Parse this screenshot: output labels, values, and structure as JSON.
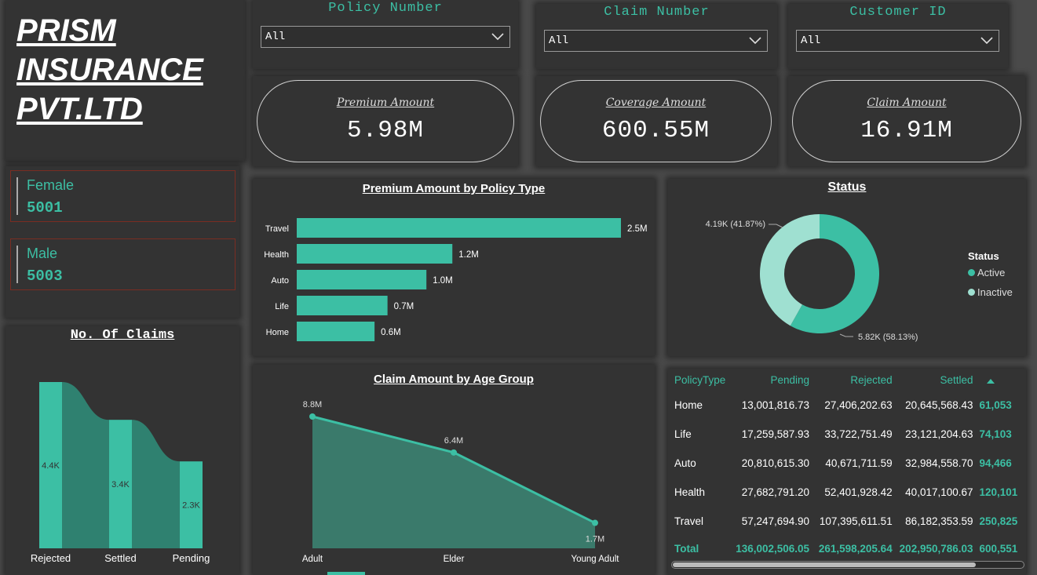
{
  "brand": {
    "line1": "PRISM ",
    "line2": "INSURANCE ",
    "line3": "PVT.LTD"
  },
  "filters": [
    {
      "label": "Policy Number",
      "value": "All"
    },
    {
      "label": "Claim Number",
      "value": "All"
    },
    {
      "label": "Customer ID",
      "value": "All"
    }
  ],
  "kpis": [
    {
      "label": "Premium Amount",
      "value": "5.98M"
    },
    {
      "label": "Coverage Amount",
      "value": "600.55M"
    },
    {
      "label": "Claim Amount",
      "value": "16.91M"
    }
  ],
  "gender": [
    {
      "label": "Female",
      "value": "5001"
    },
    {
      "label": "Male",
      "value": "5003"
    }
  ],
  "colors": {
    "accent": "#3cbfa4",
    "accent_light": "#9fe0d1",
    "panel": "#333333",
    "card_border": "#7a2d22"
  },
  "chart_data": [
    {
      "type": "bar",
      "title": "Premium Amount by Policy Type",
      "orientation": "horizontal",
      "categories": [
        "Travel",
        "Health",
        "Auto",
        "Life",
        "Home"
      ],
      "values": [
        2.5,
        1.2,
        1.0,
        0.7,
        0.6
      ],
      "labels": [
        "2.5M",
        "1.2M",
        "1.0M",
        "0.7M",
        "0.6M"
      ],
      "unit": "M"
    },
    {
      "type": "pie",
      "title": "Status",
      "legend_title": "Status",
      "legend_position": "right",
      "categories": [
        "Active",
        "Inactive"
      ],
      "values": [
        5.82,
        4.19
      ],
      "percents": [
        58.13,
        41.87
      ],
      "labels": [
        "5.82K (58.13%)",
        "4.19K (41.87%)"
      ],
      "colors": [
        "#3cbfa4",
        "#9fe0d1"
      ]
    },
    {
      "type": "bar",
      "title": "No. Of Claims",
      "subtype": "ribbon",
      "categories": [
        "Rejected",
        "Settled",
        "Pending"
      ],
      "values": [
        4.4,
        3.4,
        2.3
      ],
      "labels": [
        "4.4K",
        "3.4K",
        "2.3K"
      ]
    },
    {
      "type": "area",
      "title": "Claim Amount by Age Group",
      "categories": [
        "Adult",
        "Elder",
        "Young Adult"
      ],
      "values": [
        8.8,
        6.4,
        1.7
      ],
      "labels": [
        "8.8M",
        "6.4M",
        "1.7M"
      ]
    }
  ],
  "matrix": {
    "headers": [
      "PolicyType",
      "Pending",
      "Rejected",
      "Settled",
      ""
    ],
    "rows": [
      [
        "Home",
        "13,001,816.73",
        "27,406,202.63",
        "20,645,568.43",
        "61,053"
      ],
      [
        "Life",
        "17,259,587.93",
        "33,722,751.49",
        "23,121,204.63",
        "74,103"
      ],
      [
        "Auto",
        "20,810,615.30",
        "40,671,711.59",
        "32,984,558.70",
        "94,466"
      ],
      [
        "Health",
        "27,682,791.20",
        "52,401,928.42",
        "40,017,100.67",
        "120,101"
      ],
      [
        "Travel",
        "57,247,694.90",
        "107,395,611.51",
        "86,182,353.59",
        "250,825"
      ]
    ],
    "total": [
      "Total",
      "136,002,506.05",
      "261,598,205.64",
      "202,950,786.03",
      "600,551"
    ]
  }
}
